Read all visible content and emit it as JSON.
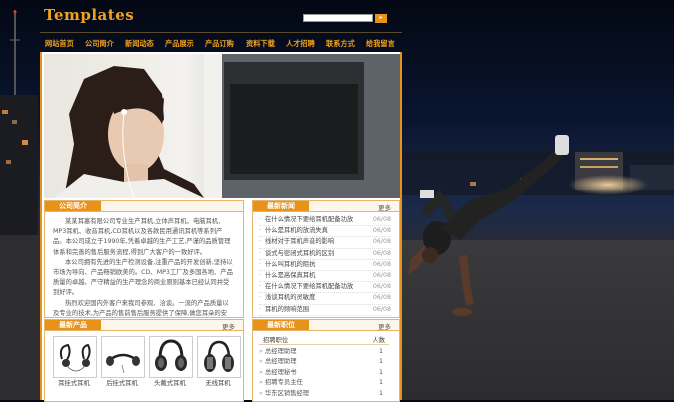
{
  "header": {
    "logo": "Templates",
    "search_placeholder": "",
    "search_button": "▸"
  },
  "nav": [
    "网站首页",
    "公司简介",
    "新闻动态",
    "产品展示",
    "产品订购",
    "资料下载",
    "人才招聘",
    "联系方式",
    "给我留言"
  ],
  "intro": {
    "title": "公司简介",
    "paragraphs": [
      "某某耳塞有限公司专业生产耳机,立体声耳机、电脑耳机、MP3耳机、收音耳机,CD耳机以及各款民用通讯耳机等系列产品。本公司成立于1990年,凭着卓越的生产工艺,严谨的品质管理体系和完善的售后服务流程,得到广大客户的一致好评。",
      "本公司拥有先进的生产检测设备,注重产品的开发创新,坚持以市场为导向、产品畅销欧美的。CD、MP3工厂及多国各地、产品质量的卓越、严守精益的生产理念的商业原则基本已经认同并受到好评。",
      "热烈欢迎国内外客户来我司参观、洽谈。一流的产品质量以及专业的技术,为产品的售前售后服务提供了保障,做您耳朵的安心、用的放心。"
    ]
  },
  "news": {
    "title": "最新新闻",
    "more": "更多",
    "items": [
      {
        "title": "在什么情况下要给耳机配备功放",
        "date": "06/08"
      },
      {
        "title": "什么是耳机的放流失真",
        "date": "06/08"
      },
      {
        "title": "线材对于耳机声音的影响",
        "date": "06/08"
      },
      {
        "title": "谈式与密闭式耳机的区别",
        "date": "06/08"
      },
      {
        "title": "什么叫耳机的阻抗",
        "date": "06/08"
      },
      {
        "title": "什么是高保真耳机",
        "date": "06/08"
      },
      {
        "title": "在什么情况下要给耳机配备功放",
        "date": "06/08"
      },
      {
        "title": "浅谈耳机的灵敏度",
        "date": "06/08"
      },
      {
        "title": "耳机的频响范围",
        "date": "06/08"
      }
    ]
  },
  "products": {
    "title": "最新产品",
    "more": "更多",
    "items": [
      {
        "label": "耳挂式耳机",
        "icon": "ear-hook-headphones-icon"
      },
      {
        "label": "后挂式耳机",
        "icon": "neckband-headphones-icon"
      },
      {
        "label": "头戴式耳机",
        "icon": "over-ear-headphones-icon"
      },
      {
        "label": "无线耳机",
        "icon": "wireless-headphones-icon"
      }
    ]
  },
  "jobs": {
    "title": "最新职位",
    "more": "更多",
    "col_position": "招聘职位",
    "col_count": "人数",
    "items": [
      {
        "title": "总经理助理",
        "count": "1"
      },
      {
        "title": "总经理助理",
        "count": "1"
      },
      {
        "title": "总经理秘书",
        "count": "1"
      },
      {
        "title": "招聘专员主任",
        "count": "1"
      },
      {
        "title": "华东区销售经理",
        "count": "1"
      }
    ]
  },
  "colors": {
    "accent": "#e8921a",
    "logo": "#f2a21e"
  }
}
